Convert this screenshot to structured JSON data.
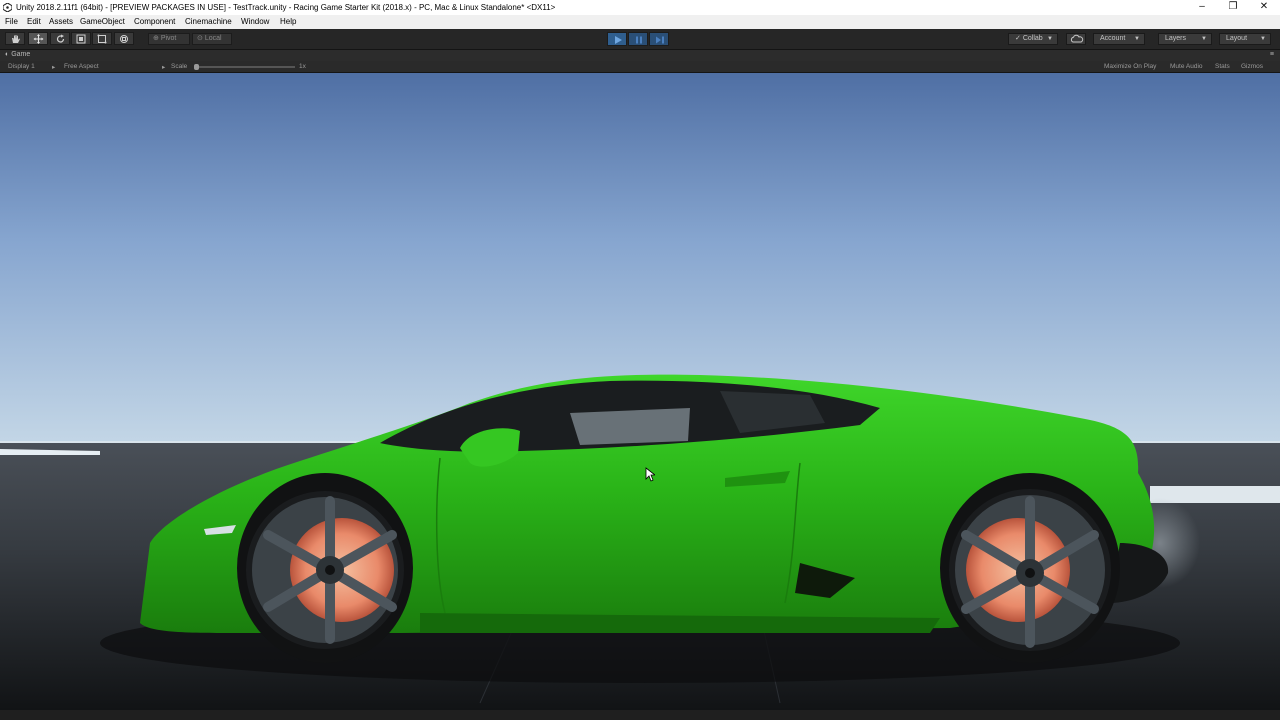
{
  "window": {
    "title": "Unity 2018.2.11f1 (64bit) - [PREVIEW PACKAGES IN USE] - TestTrack.unity - Racing Game Starter Kit (2018.x) - PC, Mac & Linux Standalone* <DX11>",
    "minimize": "–",
    "maximize": "❐",
    "close": "✕"
  },
  "menu": [
    "File",
    "Edit",
    "Assets",
    "GameObject",
    "Component",
    "Cinemachine",
    "Window",
    "Help"
  ],
  "toolbar": {
    "tools": [
      "hand-tool-icon",
      "move-tool-icon",
      "rotate-tool-icon",
      "scale-tool-icon",
      "rect-tool-icon",
      "transform-tool-icon"
    ],
    "pivot_label": "Pivot",
    "local_label": "Local",
    "collab_label": "Collab",
    "account_label": "Account",
    "layers_label": "Layers",
    "layout_label": "Layout",
    "play_accent": "#2f5e8e"
  },
  "game_panel": {
    "tab_label": "Game",
    "display": "Display 1",
    "aspect": "Free Aspect",
    "scale_label": "Scale",
    "scale_value": "1x",
    "maximize_on_play": "Maximize On Play",
    "mute_audio": "Mute Audio",
    "stats": "Stats",
    "gizmos": "Gizmos"
  },
  "scene": {
    "car_color": "#2fc11b",
    "sky_top": "#4f6fa4",
    "sky_horizon": "#c3d6e6"
  }
}
